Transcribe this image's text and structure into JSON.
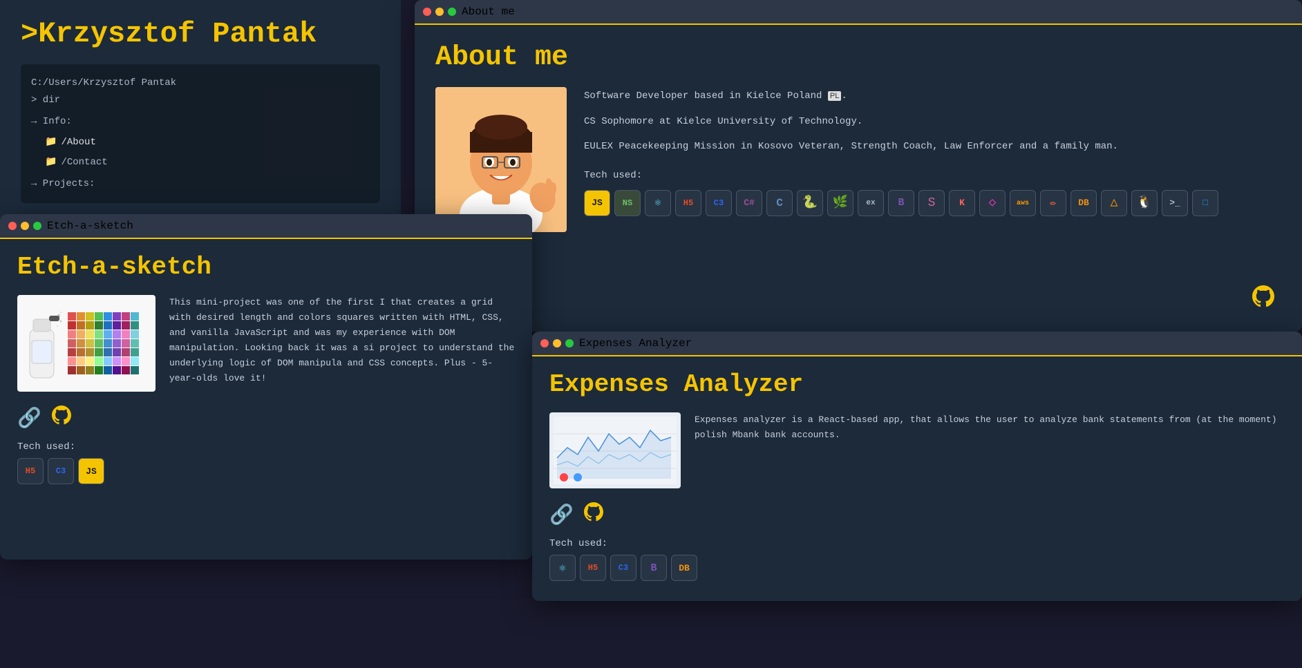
{
  "main": {
    "title": ">Krzysztof Pantak",
    "terminal": {
      "path": "C:/Users/Krzysztof Pantak",
      "cmd": "> dir",
      "info_label": "→ Info:",
      "about_link": "/About",
      "contact_link": "/Contact",
      "projects_label": "→ Projects:"
    }
  },
  "about_window": {
    "titlebar_title": "About me",
    "page_title": "About me",
    "description_line1": "Software Developer based in Kielce Poland",
    "flag": "PL",
    "description_line2": "CS Sophomore at Kielce University of Technology.",
    "description_line3": "EULEX Peacekeeping Mission in Kosovo Veteran, Strength Coach, Law Enforcer and a family man.",
    "tech_label": "Tech used:",
    "tech_icons": [
      "JS",
      "NS",
      "⚛",
      "H5",
      "C3",
      "C#",
      "C",
      "Py",
      "🌿",
      "ex",
      "B",
      "S",
      "K",
      "◇",
      "aws",
      "✏",
      "DB",
      "△",
      "🐧",
      ">_",
      "□"
    ]
  },
  "etch_window": {
    "titlebar_title": "Etch-a-sketch",
    "page_title": "Etch-a-sketch",
    "description": "This mini-project was one of the first I that creates a grid with desired length and colors squares written with HTML, CSS, and vanilla JavaScript and was my experience with DOM manipulation. Looking back it was a si project to understand the underlying logic of DOM manipula and CSS concepts. Plus - 5-year-olds love it!",
    "tech_label": "Tech used:",
    "tech_icons": [
      "H5",
      "C3",
      "JS"
    ],
    "github_link": "⊙",
    "chain_link": "🔗"
  },
  "expenses_window": {
    "titlebar_title": "Expenses Analyzer",
    "page_title": "Expenses Analyzer",
    "description": "Expenses analyzer is a React-based app, that allows the user to analyze bank statements from (at the moment) polish Mbank bank accounts.",
    "tech_label": "Tech used:",
    "tech_icons": [
      "⚛",
      "H5",
      "C3",
      "B",
      "DB"
    ],
    "github_link": "⊙",
    "chain_link": "🔗"
  },
  "colors": {
    "accent": "#f5c400",
    "bg_dark": "#1c2a3a",
    "bg_darker": "#152030",
    "text_main": "#c8d0dc",
    "border": "#4a5568"
  }
}
